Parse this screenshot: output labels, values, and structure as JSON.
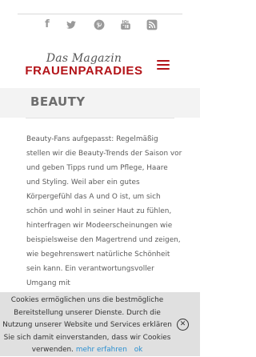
{
  "social": {
    "facebook_glyph": "f",
    "icons": [
      "facebook-icon",
      "twitter-icon",
      "pinterest-icon",
      "youtube-icon",
      "rss-icon"
    ],
    "icon_color": "#9a9a9a"
  },
  "header": {
    "logo_sub": "Das Magazin",
    "logo_main": "FRAUENPARADIES",
    "brand_color": "#b31318",
    "menu_icon": "hamburger-menu-icon"
  },
  "page": {
    "title": "BEAUTY",
    "intro": "Beauty-Fans aufgepasst: Regelmäßig stellen wir die Beauty-Trends der Saison vor und geben Tipps rund um Pflege, Haare und Styling. Weil aber ein gutes Körpergefühl das A und O ist, um sich schön und wohl in seiner Haut zu fühlen, hinterfragen wir Modeerscheinungen wie beispielsweise den Magertrend und zeigen, wie begehrenswert natürliche Schönheit sein kann. Ein verantwortungsvoller Umgang mit"
  },
  "cookie": {
    "text": "Cookies ermöglichen uns die bestmögliche Bereitstellung unserer Dienste. Durch die Nutzung unserer Website und Services erklären Sie sich damit einverstanden, dass wir Cookies verwenden.",
    "more_label": "mehr erfahren",
    "ok_label": "ok",
    "close_glyph": "✕",
    "link_color": "#2a8fd0"
  }
}
